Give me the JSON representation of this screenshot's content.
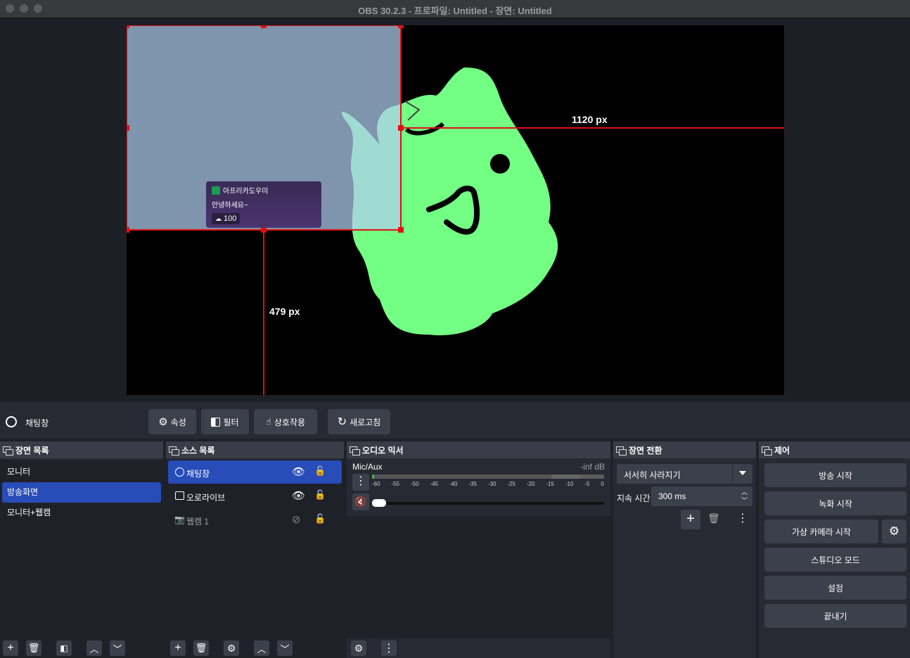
{
  "window": {
    "title": "OBS 30.2.3 - 프로파일: Untitled - 장면: Untitled"
  },
  "preview": {
    "measure_horizontal": "1120 px",
    "measure_vertical": "479 px",
    "chat": {
      "username": "아프리카도우미",
      "message": "안녕하세요~",
      "count": "100"
    }
  },
  "source_toolbar": {
    "source_name": "채팅창",
    "properties": "속성",
    "filters": "필터",
    "interact": "상호작용",
    "refresh": "새로고침"
  },
  "scenes": {
    "title": "장면 목록",
    "items": [
      "모니터",
      "방송화면",
      "모니터+웹캠"
    ],
    "selected": 1
  },
  "sources": {
    "title": "소스 목록",
    "items": [
      {
        "name": "채팅창",
        "icon": "globe-icon",
        "visible": true
      },
      {
        "name": "오로라이브",
        "icon": "image-icon",
        "visible": true
      },
      {
        "name": "웹캠 1",
        "icon": "camera-icon",
        "visible": false
      }
    ]
  },
  "mixer": {
    "title": "오디오 믹서",
    "channel": "Mic/Aux",
    "level": "-inf dB",
    "ticks": [
      "-60",
      "-55",
      "-50",
      "-45",
      "-40",
      "-35",
      "-30",
      "-25",
      "-20",
      "-15",
      "-10",
      "-5",
      "0"
    ]
  },
  "transitions": {
    "title": "장면 전환",
    "selected": "서서히 사라지기",
    "duration_label": "지속 시간",
    "duration_value": "300 ms"
  },
  "controls": {
    "title": "제어",
    "start_streaming": "방송 시작",
    "start_recording": "녹화 시작",
    "start_virtual_cam": "가상 카메라 시작",
    "studio_mode": "스튜디오 모드",
    "settings": "설정",
    "exit": "끝내기"
  },
  "colors": {
    "accent": "#284cb8",
    "selection": "#ff0000",
    "mascot": "#73ff84"
  }
}
